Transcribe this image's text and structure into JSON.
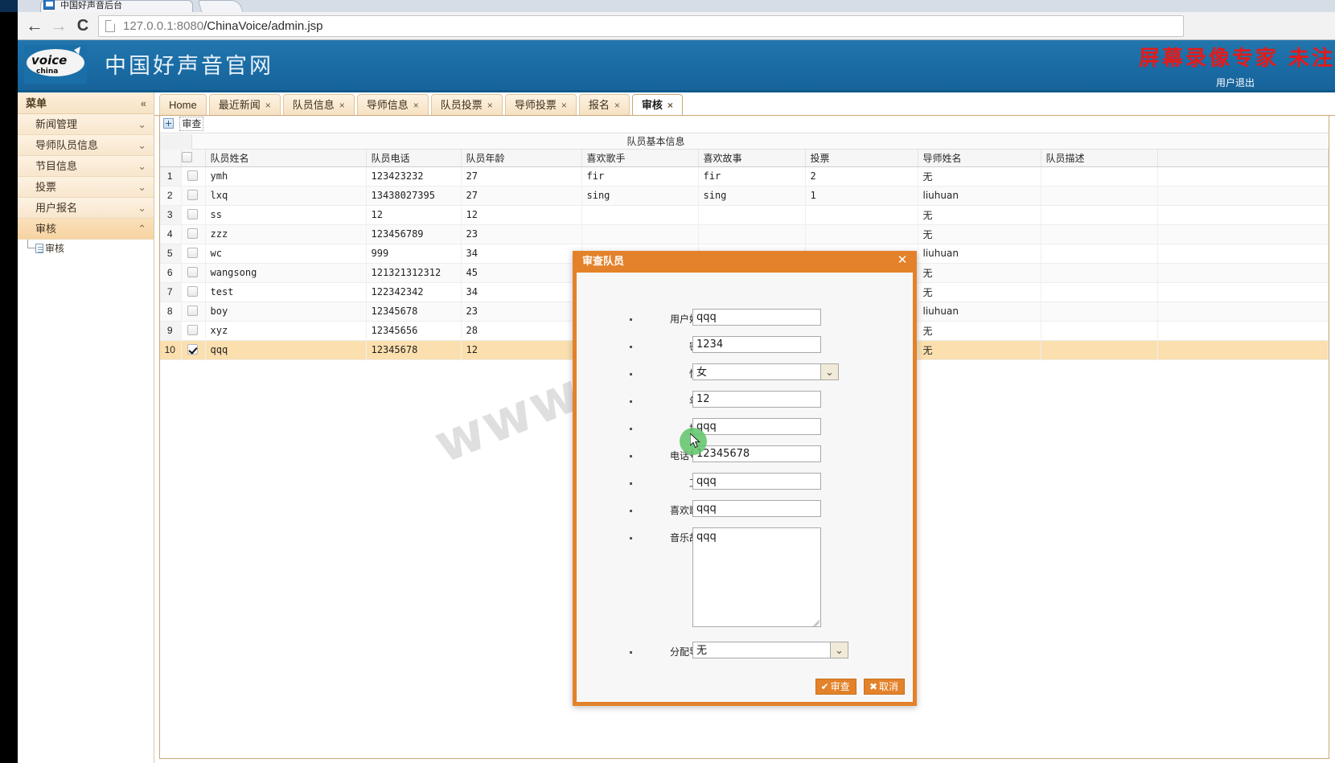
{
  "browser": {
    "tab_title": "中国好声音后台",
    "tab_close": "✕",
    "back_icon": "←",
    "forward_icon": "→",
    "reload_icon": "C",
    "url_scheme_host": "127.0.0.1:8080",
    "url_path": "/ChinaVoice/admin.jsp"
  },
  "site": {
    "title": "中国好声音官网",
    "logout": "用户退出",
    "recorder_watermark": "屏幕录像专家 未注",
    "page_watermark": "www.httrd.com"
  },
  "sidebar": {
    "head": "菜单",
    "head_chevron": "«",
    "items": [
      {
        "label": "新闻管理",
        "chevron": "⌄",
        "active": false
      },
      {
        "label": "导师队员信息",
        "chevron": "⌄",
        "active": false
      },
      {
        "label": "节目信息",
        "chevron": "⌄",
        "active": false
      },
      {
        "label": "投票",
        "chevron": "⌄",
        "active": false
      },
      {
        "label": "用户报名",
        "chevron": "⌄",
        "active": false
      },
      {
        "label": "审核",
        "chevron": "⌃",
        "active": true
      }
    ],
    "sub_items": [
      {
        "label": "审核"
      }
    ]
  },
  "tabs": [
    {
      "label": "Home",
      "closable": false,
      "active": false
    },
    {
      "label": "最近新闻",
      "closable": true,
      "active": false
    },
    {
      "label": "队员信息",
      "closable": true,
      "active": false
    },
    {
      "label": "导师信息",
      "closable": true,
      "active": false
    },
    {
      "label": "队员投票",
      "closable": true,
      "active": false
    },
    {
      "label": "导师投票",
      "closable": true,
      "active": false
    },
    {
      "label": "报名",
      "closable": true,
      "active": false
    },
    {
      "label": "审核",
      "closable": true,
      "active": true
    }
  ],
  "panel": {
    "title": "审查"
  },
  "grid": {
    "group_title": "队员基本信息",
    "columns": [
      "队员姓名",
      "队员电话",
      "队员年龄",
      "喜欢歌手",
      "喜欢故事",
      "投票",
      "导师姓名",
      "队员描述"
    ],
    "rows": [
      {
        "idx": "1",
        "checked": false,
        "name": "ymh",
        "phone": "123423232",
        "age": "27",
        "singer": "fir",
        "story": "fir",
        "votes": "2",
        "mentor": "无",
        "desc": ""
      },
      {
        "idx": "2",
        "checked": false,
        "name": "lxq",
        "phone": "13438027395",
        "age": "27",
        "singer": "sing",
        "story": "sing",
        "votes": "1",
        "mentor": "liuhuan",
        "desc": ""
      },
      {
        "idx": "3",
        "checked": false,
        "name": "ss",
        "phone": "12",
        "age": "12",
        "singer": "",
        "story": "",
        "votes": "",
        "mentor": "无",
        "desc": ""
      },
      {
        "idx": "4",
        "checked": false,
        "name": "zzz",
        "phone": "123456789",
        "age": "23",
        "singer": "",
        "story": "",
        "votes": "",
        "mentor": "无",
        "desc": ""
      },
      {
        "idx": "5",
        "checked": false,
        "name": "wc",
        "phone": "999",
        "age": "34",
        "singer": "",
        "story": "",
        "votes": "",
        "mentor": "liuhuan",
        "desc": ""
      },
      {
        "idx": "6",
        "checked": false,
        "name": "wangsong",
        "phone": "121321312312",
        "age": "45",
        "singer": "",
        "story": "",
        "votes": "",
        "mentor": "无",
        "desc": ""
      },
      {
        "idx": "7",
        "checked": false,
        "name": "test",
        "phone": "122342342",
        "age": "34",
        "singer": "",
        "story": "",
        "votes": "",
        "mentor": "无",
        "desc": ""
      },
      {
        "idx": "8",
        "checked": false,
        "name": "boy",
        "phone": "12345678",
        "age": "23",
        "singer": "",
        "story": "",
        "votes": "",
        "mentor": "liuhuan",
        "desc": ""
      },
      {
        "idx": "9",
        "checked": false,
        "name": "xyz",
        "phone": "12345656",
        "age": "28",
        "singer": "",
        "story": "",
        "votes": "",
        "mentor": "无",
        "desc": ""
      },
      {
        "idx": "10",
        "checked": true,
        "name": "qqq",
        "phone": "12345678",
        "age": "12",
        "singer": "",
        "story": "",
        "votes": "",
        "mentor": "无",
        "desc": ""
      }
    ]
  },
  "dialog": {
    "title": "审查队员",
    "close": "✕",
    "fields": {
      "username_label": "用户姓名：",
      "username_value": "qqq",
      "password_label": "密码：",
      "password_value": "1234",
      "gender_label": "性别：",
      "gender_value": "女",
      "age_label": "年龄：",
      "age_value": "12",
      "address_label": "地址：",
      "address_value": "qqq",
      "phone_label": "电话号码：",
      "phone_value": "12345678",
      "job_label": "工作：",
      "job_value": "qqq",
      "singer_label": "喜欢歌手：",
      "singer_value": "qqq",
      "story_label": "音乐故事：",
      "story_value": "qqq",
      "mentor_label": "分配导师：",
      "mentor_value": "无"
    },
    "caret_icon": "⌄",
    "buttons": {
      "confirm_icon": "✔",
      "confirm_label": "审查",
      "cancel_icon": "✖",
      "cancel_label": "取消"
    }
  }
}
